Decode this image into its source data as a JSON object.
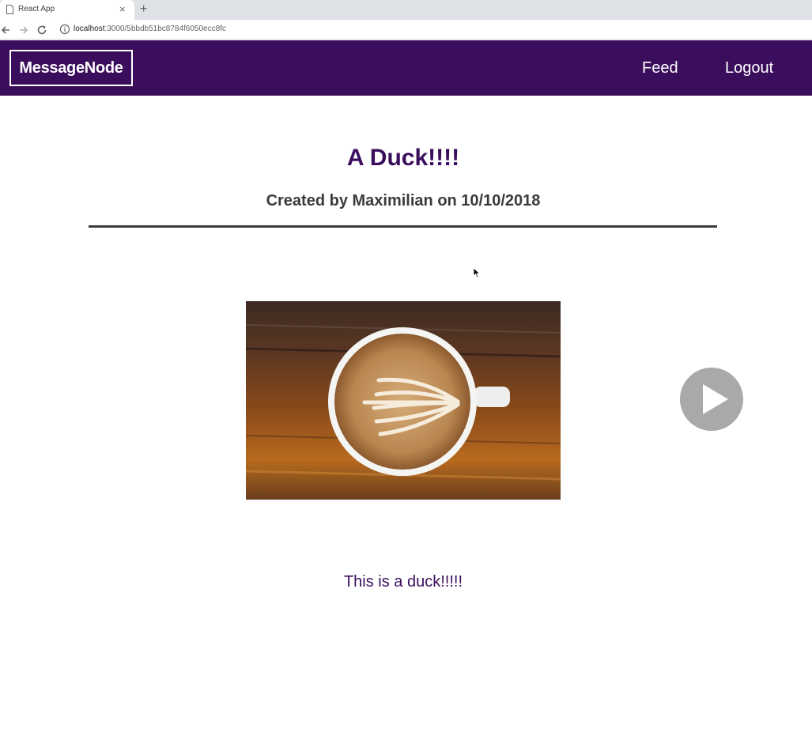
{
  "browser": {
    "tab_title": "React App",
    "url_host": "localhost",
    "url_path": ":3000/5bbdb51bc8784f6050ecc8fc"
  },
  "header": {
    "logo": "MessageNode",
    "nav": {
      "feed": "Feed",
      "logout": "Logout"
    },
    "background_color": "#3b0e5d"
  },
  "post": {
    "title": "A Duck!!!!",
    "meta": "Created by Maximilian on 10/10/2018",
    "image": "coffee-latte-art-on-wooden-table",
    "content": "This is a duck!!!!!"
  },
  "overlay": {
    "play_button_icon": "play-icon"
  },
  "colors": {
    "accent": "#3b0e5d",
    "text_dark": "#3a3a3a"
  }
}
